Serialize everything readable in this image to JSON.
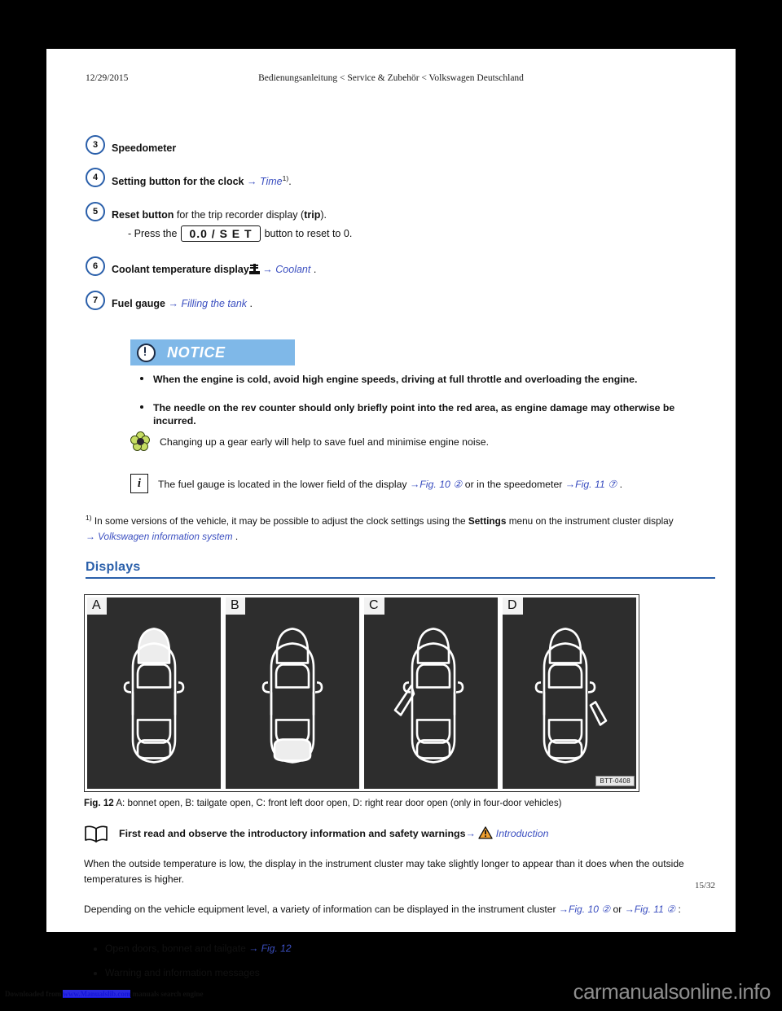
{
  "header": {
    "date": "12/29/2015",
    "breadcrumb": "Bedienungsanleitung < Service & Zubehör < Volkswagen Deutschland"
  },
  "numbered_items": [
    {
      "num": "3",
      "label": "Speedometer",
      "label_bold": "Speedometer",
      "rest": "",
      "xref": "",
      "note": ""
    },
    {
      "num": "4",
      "label_bold": "Setting button for the clock",
      "arrow": "→",
      "xref": "Time",
      "sup": "1)",
      "tail": "."
    },
    {
      "num": "5",
      "label_bold": "Reset button",
      "rest": " for the trip recorder display (",
      "bold2": "trip",
      "tail": ")."
    }
  ],
  "item5_sub": {
    "prefix": "- Press the",
    "button_label": "0.0 / S E T",
    "suffix": "button to reset to 0."
  },
  "item6": {
    "num": "6",
    "label_bold": "Coolant temperature display",
    "arrow": "→",
    "xref": "Coolant",
    "tail": "."
  },
  "item7": {
    "num": "7",
    "label_bold": "Fuel gauge",
    "arrow": "→",
    "xref": "Filling the tank",
    "tail": "."
  },
  "notice": {
    "label": "NOTICE",
    "bar_color": "#7fb8e8",
    "bullets": [
      "When the engine is cold, avoid high engine speeds, driving at full throttle and overloading the engine.",
      "The needle on the rev counter should only briefly point into the red area, as engine damage may otherwise be incurred."
    ]
  },
  "tip": {
    "icon": "flower-icon",
    "text": "Changing up a gear early will help to save fuel and minimise engine noise."
  },
  "info": {
    "icon": "info-icon",
    "text_a": "The fuel gauge is located in the lower field of the display",
    "xref_a": "Fig. 10",
    "circ_a": "②",
    "text_b": "or in the speedometer",
    "xref_b": "Fig. 11",
    "circ_b": "⑦",
    "tail": "."
  },
  "footnote": {
    "marker": "1)",
    "text_a": "In some versions of the vehicle, it may be possible to adjust the clock settings using the",
    "bold": "Settings",
    "text_b": "menu on the instrument cluster display",
    "arrow": "→",
    "xref": "Volkswagen information system",
    "tail": "."
  },
  "section": {
    "heading": "Displays"
  },
  "figure": {
    "panels": [
      {
        "letter": "A",
        "state": "bonnet-open"
      },
      {
        "letter": "B",
        "state": "tailgate-open"
      },
      {
        "letter": "C",
        "state": "front-left-door-open"
      },
      {
        "letter": "D",
        "state": "right-rear-door-open"
      }
    ],
    "code": "BTT-0408",
    "caption_bold": "Fig. 12",
    "caption": "A: bonnet open, B: tailgate open, C: front left door open, D: right rear door open (only in four-door vehicles)"
  },
  "read_first": {
    "icon": "book-icon",
    "text": "First read and observe the introductory information and safety warnings",
    "arrow": "→",
    "warning_icon": "warning-triangle-icon",
    "xref": "Introduction"
  },
  "body": {
    "para1": "When the outside temperature is low, the display in the instrument cluster may take slightly longer to appear than it does when the outside temperatures is higher.",
    "para2_a": "Depending on the vehicle equipment level, a variety of information can be displayed in the instrument cluster",
    "para2_xref_a": "Fig. 10",
    "para2_circ_a": "②",
    "para2_or": "or",
    "para2_xref_b": "Fig. 11",
    "para2_circ_b": "②",
    "para2_tail": ":",
    "bullets": [
      {
        "text": "Open doors, bonnet and tailgate",
        "arrow": "→",
        "xref": "Fig. 12"
      },
      {
        "text": "Warning and information messages",
        "arrow": "",
        "xref": ""
      }
    ]
  },
  "page_number": "15/32",
  "site_footer": {
    "prefix": "Downloaded from",
    "link": "www.Manualslib.com",
    "suffix": "manuals search engine",
    "brand": "carmanualsonline.info"
  },
  "colors": {
    "accent_blue": "#2a5faa",
    "xref_blue": "#3b4fc0",
    "notice_blue": "#7fb8e8",
    "panel_bg": "#2d2d2d",
    "warning_orange": "#f0a030"
  }
}
